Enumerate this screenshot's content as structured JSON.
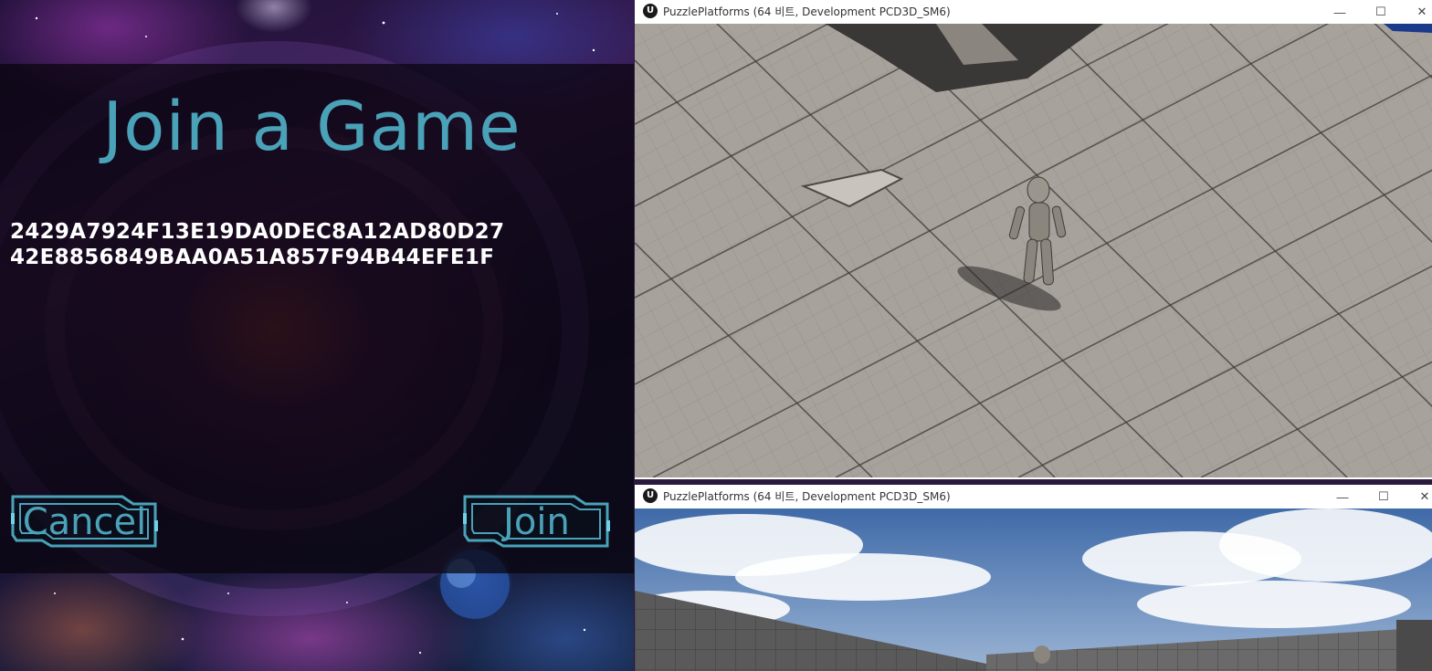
{
  "game_menu": {
    "title": "Join a Game",
    "address_lines": [
      "2429A7924F13E19DA0DEC8A12AD80D27",
      "42E8856849BAA0A51A857F94B44EFE1F"
    ],
    "cancel_label": "Cancel",
    "join_label": "Join",
    "accent_color": "#4aa2b8"
  },
  "windows": [
    {
      "logo": "U",
      "title": "PuzzlePlatforms (64 비트, Development PCD3D_SM6)",
      "controls": {
        "minimize": "—",
        "maximize": "☐",
        "close": "✕"
      },
      "view": "top-down gray grid floor with a humanoid mannequin"
    },
    {
      "logo": "U",
      "title": "PuzzlePlatforms (64 비트, Development PCD3D_SM6)",
      "controls": {
        "minimize": "—",
        "maximize": "☐",
        "close": "✕"
      },
      "view": "blue sky with clouds over gray grid walls"
    }
  ]
}
